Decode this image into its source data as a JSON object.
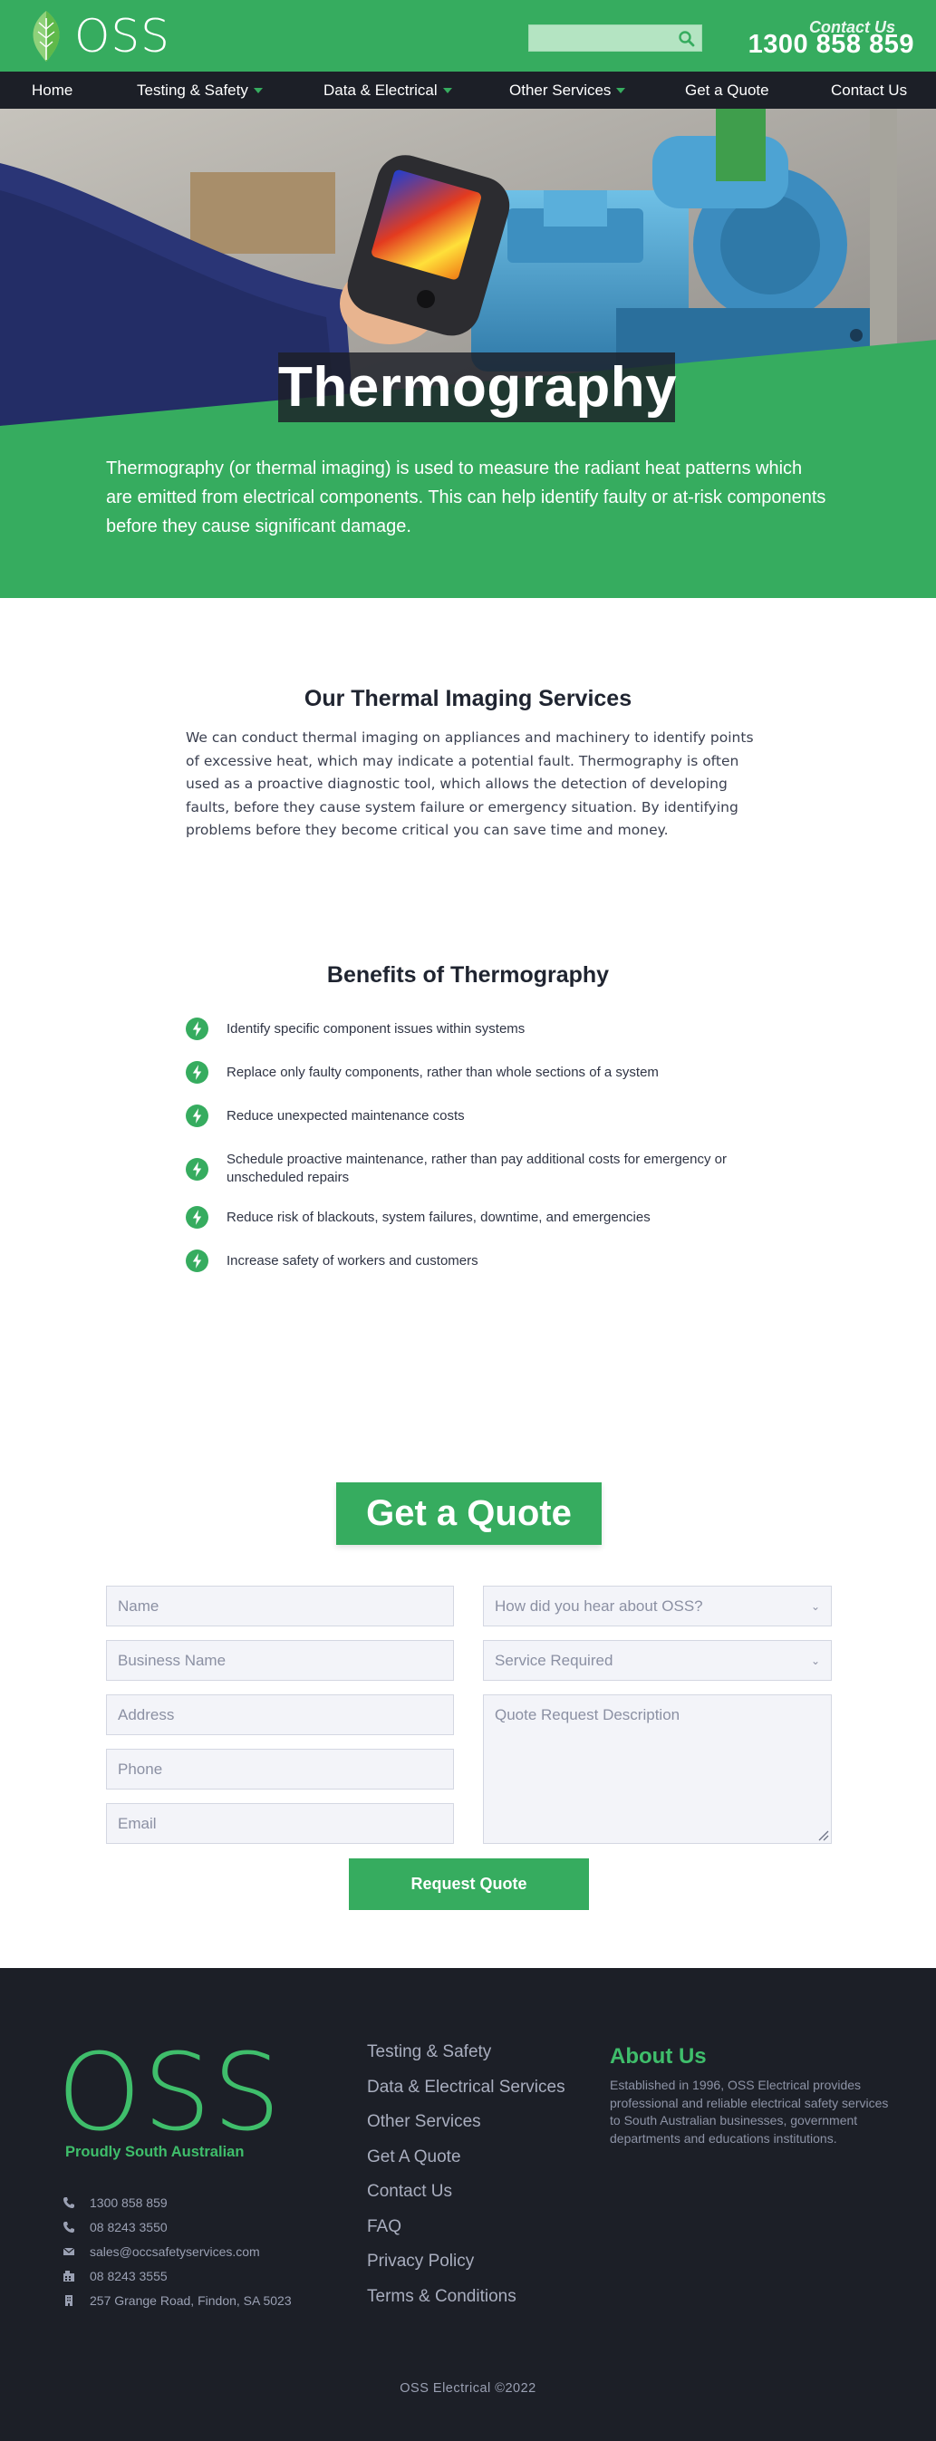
{
  "header": {
    "logo_text": "OSS",
    "search_placeholder": "",
    "contact_label": "Contact Us",
    "phone": "1300 858 859"
  },
  "nav": {
    "items": [
      {
        "label": "Home",
        "has_dropdown": false
      },
      {
        "label": "Testing & Safety",
        "has_dropdown": true
      },
      {
        "label": "Data & Electrical",
        "has_dropdown": true
      },
      {
        "label": "Other Services",
        "has_dropdown": true
      },
      {
        "label": "Get a Quote",
        "has_dropdown": false
      },
      {
        "label": "Contact Us",
        "has_dropdown": false
      }
    ]
  },
  "hero": {
    "title": "Thermography",
    "description": "Thermography (or thermal imaging) is used to measure the radiant heat patterns which are emitted from electrical components. This can help identify faulty or at-risk components before they cause significant damage."
  },
  "services": {
    "title": "Our Thermal Imaging Services",
    "body": "We can conduct thermal imaging on appliances and machinery to identify points of excessive heat, which may indicate a potential fault. Thermography is often used as a proactive diagnostic tool, which allows the detection of developing faults, before they cause system failure or emergency situation. By identifying problems before they become critical you can save time and money."
  },
  "benefits": {
    "title": "Benefits of Thermography",
    "items": [
      "Identify specific component issues within systems",
      "Replace only faulty components, rather than whole sections of a system",
      "Reduce unexpected maintenance costs",
      "Schedule proactive maintenance, rather than pay additional costs for emergency or unscheduled repairs",
      "Reduce risk of blackouts, system failures, downtime, and emergencies",
      "Increase safety of workers and customers"
    ]
  },
  "quote": {
    "title": "Get a Quote",
    "name_placeholder": "Name",
    "business_placeholder": "Business Name",
    "address_placeholder": "Address",
    "phone_placeholder": "Phone",
    "email_placeholder": "Email",
    "heard_about_select": "How did you hear about OSS?",
    "service_select": "Service Required",
    "description_placeholder": "Quote Request Description",
    "submit_label": "Request Quote"
  },
  "footer": {
    "logo_text": "OSS",
    "tagline": "Proudly South Australian",
    "contacts": [
      {
        "icon": "phone-icon",
        "text": "1300 858 859"
      },
      {
        "icon": "phone-icon",
        "text": "08 8243 3550"
      },
      {
        "icon": "envelope-icon",
        "text": "sales@occsafetyservices.com"
      },
      {
        "icon": "fax-icon",
        "text": "08 8243 3555"
      },
      {
        "icon": "building-icon",
        "text": "257 Grange Road, Findon, SA 5023"
      }
    ],
    "links": [
      "Testing & Safety",
      "Data & Electrical Services",
      "Other Services",
      "Get A Quote",
      "Contact Us",
      "FAQ",
      "Privacy Policy",
      "Terms & Conditions"
    ],
    "about_title": "About Us",
    "about_text": "Established in 1996, OSS Electrical provides professional and reliable electrical safety services to South Australian businesses, government departments and educations institutions.",
    "copyright": "OSS Electrical ©2022"
  },
  "colors": {
    "brand_green": "#36ac5f",
    "dark": "#1c1f27"
  }
}
